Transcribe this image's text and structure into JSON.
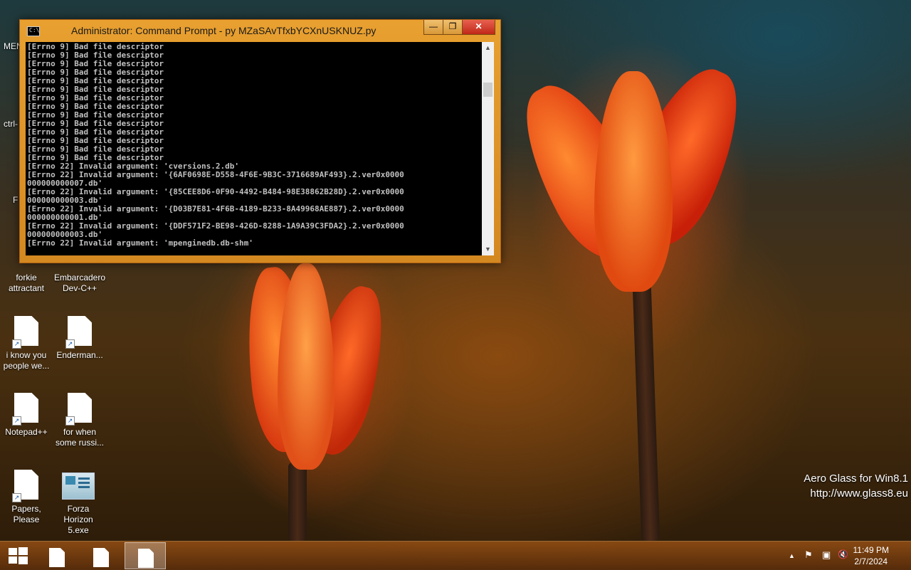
{
  "desktop": {
    "partial_labels": {
      "menu": "MEN",
      "ctrl": "ctrl-",
      "f": "F"
    },
    "icons": [
      {
        "line1": "forkie",
        "line2": "attractant"
      },
      {
        "line1": "Embarcadero",
        "line2": "Dev-C++"
      },
      {
        "line1": "i know you",
        "line2": "people we..."
      },
      {
        "line1": "Enderman...",
        "line2": ""
      },
      {
        "line1": "Notepad++",
        "line2": ""
      },
      {
        "line1": "for when",
        "line2": "some russi..."
      },
      {
        "line1": "Papers,",
        "line2": "Please"
      },
      {
        "line1": "Forza",
        "line2": "Horizon 5.exe"
      }
    ],
    "watermark": {
      "line1": "Aero Glass for Win8.1",
      "line2": "http://www.glass8.eu"
    }
  },
  "window": {
    "title": "Administrator: Command Prompt - py  MZaSAvTfxbYCXnUSKNUZ.py",
    "icon_text": "C:\\",
    "buttons": {
      "minimize": "—",
      "maximize": "❐",
      "close": "✕"
    },
    "console_text": "[Errno 9] Bad file descriptor\n[Errno 9] Bad file descriptor\n[Errno 9] Bad file descriptor\n[Errno 9] Bad file descriptor\n[Errno 9] Bad file descriptor\n[Errno 9] Bad file descriptor\n[Errno 9] Bad file descriptor\n[Errno 9] Bad file descriptor\n[Errno 9] Bad file descriptor\n[Errno 9] Bad file descriptor\n[Errno 9] Bad file descriptor\n[Errno 9] Bad file descriptor\n[Errno 9] Bad file descriptor\n[Errno 9] Bad file descriptor\n[Errno 22] Invalid argument: 'cversions.2.db'\n[Errno 22] Invalid argument: '{6AF0698E-D558-4F6E-9B3C-3716689AF493}.2.ver0x0000\n000000000007.db'\n[Errno 22] Invalid argument: '{85CEE8D6-0F90-4492-B484-98E38862B28D}.2.ver0x0000\n000000000003.db'\n[Errno 22] Invalid argument: '{D03B7E81-4F6B-4189-B233-8A49968AE887}.2.ver0x0000\n000000000001.db'\n[Errno 22] Invalid argument: '{DDF571F2-BE98-426D-8288-1A9A39C3FDA2}.2.ver0x0000\n000000000003.db'\n[Errno 22] Invalid argument: 'mpenginedb.db-shm'",
    "scroll_up": "▲",
    "scroll_down": "▼"
  },
  "taskbar": {
    "tray": {
      "show_hidden": "▲",
      "flag": "⚑",
      "network": "▣",
      "volume": "🔇"
    },
    "clock": {
      "time": "11:49 PM",
      "date": "2/7/2024"
    }
  }
}
